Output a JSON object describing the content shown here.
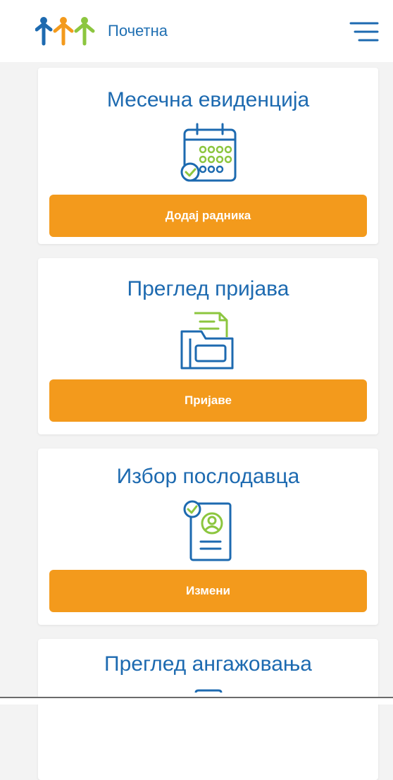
{
  "header": {
    "title": "Почетна"
  },
  "cards": [
    {
      "title": "Месечна евиденција",
      "button_label": "Додај радника",
      "icon": "calendar-icon"
    },
    {
      "title": "Преглед пријава",
      "button_label": "Пријаве",
      "icon": "folder-document-icon"
    },
    {
      "title": "Избор послодавца",
      "button_label": "Измени",
      "icon": "employer-profile-icon"
    },
    {
      "title": "Преглед ангажовања",
      "icon": "document-icon"
    }
  ],
  "colors": {
    "primary_blue": "#1d6ab0",
    "accent_orange": "#f39a1c",
    "accent_green": "#8cc63f",
    "background": "#f3f3f3"
  }
}
